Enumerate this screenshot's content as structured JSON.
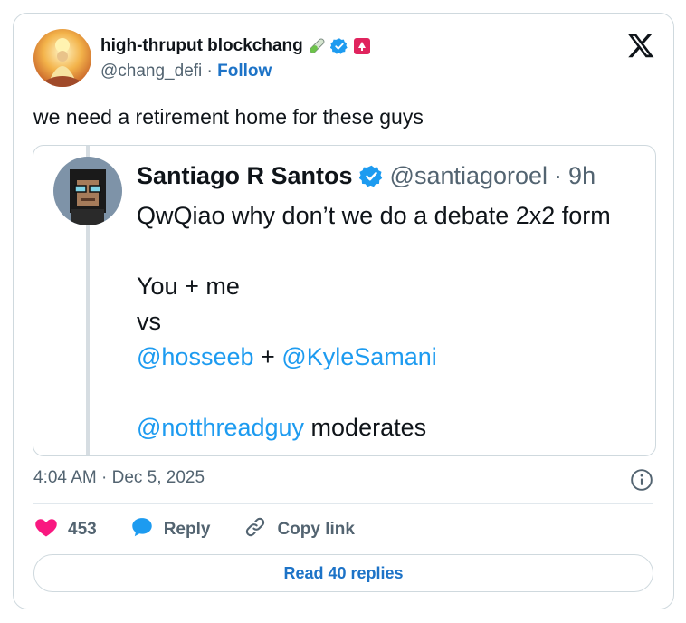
{
  "author": {
    "display_name": "high-thruput blockchang",
    "handle": "@chang_defi",
    "separator": "·",
    "follow_label": "Follow",
    "icons": [
      "test-tube-icon",
      "verified-icon",
      "red-badge-icon"
    ]
  },
  "tweet": {
    "text": "we need a retirement home for these guys"
  },
  "quoted": {
    "display_name": "Santiago R Santos",
    "handle": "@santiagoroel",
    "separator": "·",
    "time_ago": "9h",
    "lines": [
      {
        "parts": [
          {
            "text": "QwQiao why don’t we do a debate 2x2 form",
            "mention": false
          }
        ]
      },
      {
        "parts": []
      },
      {
        "parts": [
          {
            "text": "You + me",
            "mention": false
          }
        ]
      },
      {
        "parts": [
          {
            "text": "vs",
            "mention": false
          }
        ]
      },
      {
        "parts": [
          {
            "text": "@hosseeb",
            "mention": true
          },
          {
            "text": " + ",
            "mention": false
          },
          {
            "text": "@KyleSamani",
            "mention": true
          }
        ]
      },
      {
        "parts": []
      },
      {
        "parts": [
          {
            "text": "@notthreadguy",
            "mention": true
          },
          {
            "text": " moderates",
            "mention": false
          }
        ]
      }
    ]
  },
  "meta": {
    "time": "4:04 AM",
    "separator": "·",
    "date": "Dec 5, 2025"
  },
  "actions": {
    "like_count": "453",
    "reply_label": "Reply",
    "copy_link_label": "Copy link"
  },
  "read_replies_label": "Read 40 replies",
  "colors": {
    "link_blue": "#1d73c7",
    "mention_blue": "#1d9bf0",
    "like_pink": "#f91880",
    "muted_text": "#536471",
    "border": "#cfd9de"
  }
}
